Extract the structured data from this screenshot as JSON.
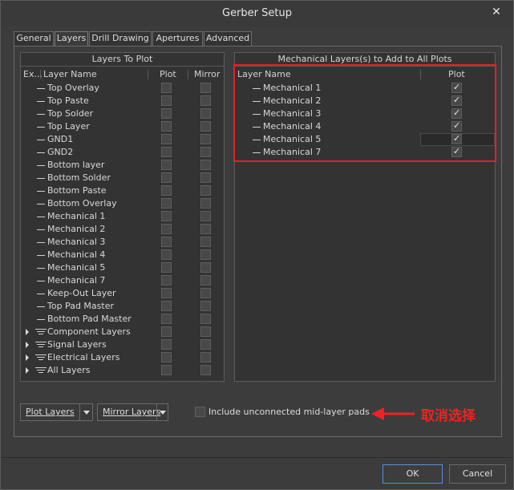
{
  "window": {
    "title": "Gerber Setup",
    "close_glyph": "✕"
  },
  "tabs": [
    {
      "label": "General",
      "active": false
    },
    {
      "label": "Layers",
      "active": true
    },
    {
      "label": "Drill Drawing",
      "active": false
    },
    {
      "label": "Apertures",
      "active": false
    },
    {
      "label": "Advanced",
      "active": false
    }
  ],
  "layers_to_plot": {
    "header": "Layers To Plot",
    "columns": {
      "ext": "Ex...",
      "name": "Layer Name",
      "plot": "Plot",
      "mirror": "Mirror"
    },
    "rows": [
      {
        "name": "Top Overlay",
        "kind": "layer",
        "plot": false,
        "mirror": false
      },
      {
        "name": "Top Paste",
        "kind": "layer",
        "plot": false,
        "mirror": false
      },
      {
        "name": "Top Solder",
        "kind": "layer",
        "plot": false,
        "mirror": false
      },
      {
        "name": "Top Layer",
        "kind": "layer",
        "plot": false,
        "mirror": false
      },
      {
        "name": "GND1",
        "kind": "layer",
        "plot": false,
        "mirror": false
      },
      {
        "name": "GND2",
        "kind": "layer",
        "plot": false,
        "mirror": false
      },
      {
        "name": "Bottom layer",
        "kind": "layer",
        "plot": false,
        "mirror": false
      },
      {
        "name": "Bottom Solder",
        "kind": "layer",
        "plot": false,
        "mirror": false
      },
      {
        "name": "Bottom Paste",
        "kind": "layer",
        "plot": false,
        "mirror": false
      },
      {
        "name": "Bottom Overlay",
        "kind": "layer",
        "plot": false,
        "mirror": false
      },
      {
        "name": "Mechanical 1",
        "kind": "layer",
        "plot": false,
        "mirror": false
      },
      {
        "name": "Mechanical 2",
        "kind": "layer",
        "plot": false,
        "mirror": false
      },
      {
        "name": "Mechanical 3",
        "kind": "layer",
        "plot": false,
        "mirror": false
      },
      {
        "name": "Mechanical 4",
        "kind": "layer",
        "plot": false,
        "mirror": false
      },
      {
        "name": "Mechanical 5",
        "kind": "layer",
        "plot": false,
        "mirror": false
      },
      {
        "name": "Mechanical 7",
        "kind": "layer",
        "plot": false,
        "mirror": false
      },
      {
        "name": "Keep-Out Layer",
        "kind": "layer",
        "plot": false,
        "mirror": false
      },
      {
        "name": "Top Pad Master",
        "kind": "layer",
        "plot": false,
        "mirror": false
      },
      {
        "name": "Bottom Pad Master",
        "kind": "layer",
        "plot": false,
        "mirror": false
      },
      {
        "name": "Component Layers",
        "kind": "group",
        "plot": false,
        "mirror": false
      },
      {
        "name": "Signal Layers",
        "kind": "group",
        "plot": false,
        "mirror": false
      },
      {
        "name": "Electrical Layers",
        "kind": "group",
        "plot": false,
        "mirror": false
      },
      {
        "name": "All Layers",
        "kind": "group",
        "plot": false,
        "mirror": false
      }
    ]
  },
  "mechanical_layers": {
    "header": "Mechanical Layers(s) to Add to All Plots",
    "columns": {
      "name": "Layer Name",
      "plot": "Plot"
    },
    "rows": [
      {
        "name": "Mechanical 1",
        "plot": true
      },
      {
        "name": "Mechanical 2",
        "plot": true
      },
      {
        "name": "Mechanical 3",
        "plot": true
      },
      {
        "name": "Mechanical 4",
        "plot": true
      },
      {
        "name": "Mechanical 5",
        "plot": true
      },
      {
        "name": "Mechanical 7",
        "plot": true
      }
    ]
  },
  "bottom": {
    "plot_layers_button": "Plot Layers",
    "mirror_layers_button": "Mirror Layers",
    "include_unconnected": {
      "label": "Include unconnected mid-layer pads",
      "checked": false
    }
  },
  "annotation": {
    "text": "取消选择",
    "color": "#ee2222"
  },
  "footer": {
    "ok": "OK",
    "cancel": "Cancel"
  },
  "colors": {
    "highlight_box": "#e0202a",
    "primary_button_border": "#5a8ed6"
  }
}
